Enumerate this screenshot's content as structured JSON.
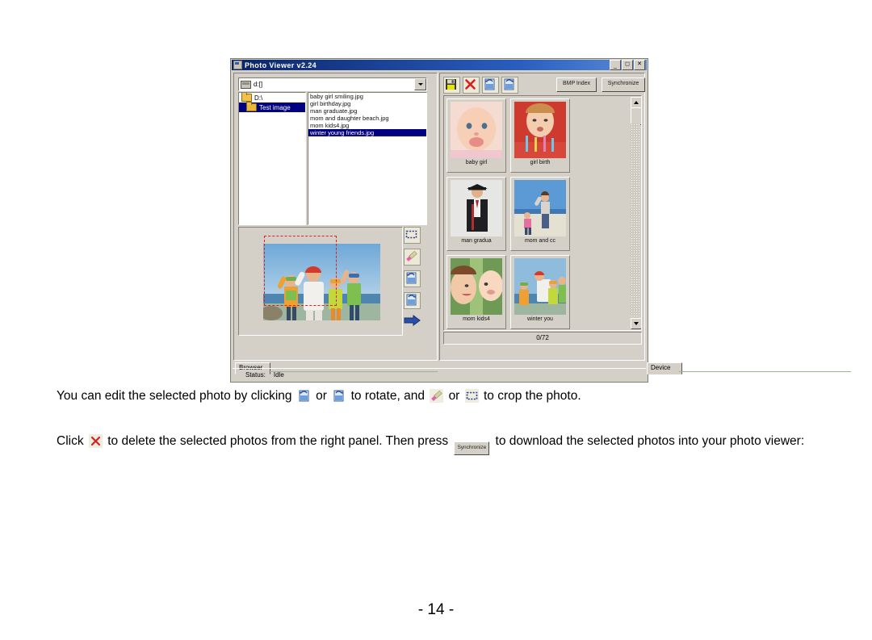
{
  "window": {
    "title": "Photo Viewer v2.24",
    "icon": "app-icon",
    "buttons": {
      "minimize": "_",
      "maximize": "□",
      "close": "✕"
    }
  },
  "browser": {
    "path_combo": {
      "value": "d:[]",
      "icon": "drive-icon"
    },
    "tree": [
      {
        "label": "D:\\",
        "selected": false
      },
      {
        "label": "Test image",
        "selected": true
      }
    ],
    "files": [
      {
        "name": "baby girl smiling.jpg",
        "selected": false
      },
      {
        "name": "girl birthday.jpg",
        "selected": false
      },
      {
        "name": "man graduate.jpg",
        "selected": false
      },
      {
        "name": "mom and daughter beach.jpg",
        "selected": false
      },
      {
        "name": "mom kids4.jpg",
        "selected": false
      },
      {
        "name": "winter young friends.jpg",
        "selected": true
      }
    ],
    "preview": {
      "alt": "winter young friends",
      "crop_marquee": true
    },
    "edit_tools": [
      {
        "name": "crop-icon"
      },
      {
        "name": "pencil-icon"
      },
      {
        "name": "rotate-left-icon"
      },
      {
        "name": "rotate-right-icon"
      },
      {
        "name": "transfer-arrow-icon"
      }
    ],
    "tab": "Browser"
  },
  "device": {
    "toolbar": [
      {
        "name": "save-icon"
      },
      {
        "name": "delete-icon"
      },
      {
        "name": "rotate-left-icon"
      },
      {
        "name": "rotate-right-icon"
      }
    ],
    "bmp_index_label": "BMP Index",
    "synchronize_label": "Synchronize",
    "thumbnails": [
      {
        "caption": "baby girl"
      },
      {
        "caption": "girl birth"
      },
      {
        "caption": "man gradua"
      },
      {
        "caption": "mom and cc"
      },
      {
        "caption": "mom kids4"
      },
      {
        "caption": "winter you"
      }
    ],
    "counter": "0/72",
    "tab": "Device"
  },
  "statusbar": {
    "label": "Status:",
    "value": "Idle"
  },
  "document": {
    "p1_a": "You can edit the selected photo by clicking",
    "p1_b": "or",
    "p1_c": "to rotate, and",
    "p1_d": "or",
    "p1_e": "to crop the photo.",
    "p2_a": "Click",
    "p2_b": "to delete the selected photos from the right panel. Then press",
    "p2_btn": "Synchronize",
    "p2_c": "to download the selected photos into your photo viewer:",
    "page_number": "- 14 -"
  },
  "colors": {
    "titlebar": "#0a246a",
    "face": "#d4d0c8",
    "selection": "#000080",
    "marquee": "#e02020"
  }
}
